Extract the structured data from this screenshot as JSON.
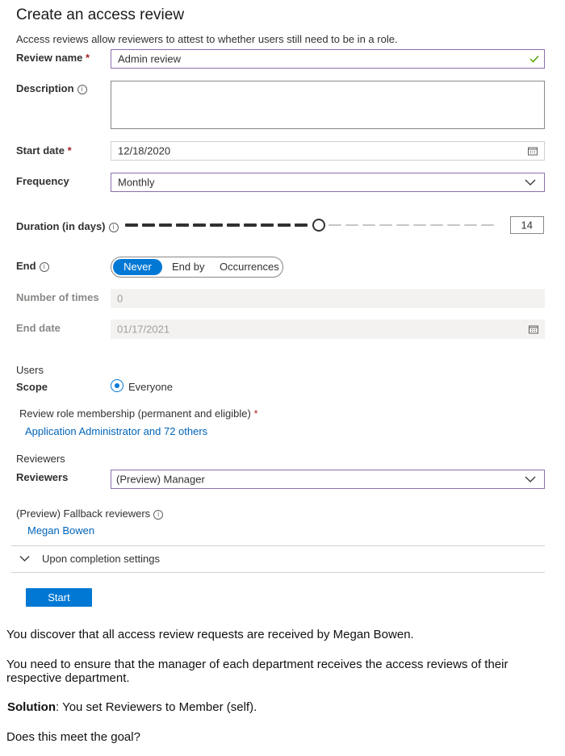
{
  "form": {
    "title": "Create an access review",
    "intro": "Access reviews allow reviewers to attest to whether users still need to be in a role.",
    "review_name": {
      "label": "Review name",
      "required_mark": "*",
      "value": "Admin review"
    },
    "description": {
      "label": "Description",
      "value": ""
    },
    "start_date": {
      "label": "Start date",
      "required_mark": "*",
      "value": "12/18/2020"
    },
    "frequency": {
      "label": "Frequency",
      "value": "Monthly"
    },
    "duration": {
      "label": "Duration (in days)",
      "value": "14",
      "slider_fraction": 0.51
    },
    "end": {
      "label": "End",
      "options": [
        "Never",
        "End by",
        "Occurrences"
      ],
      "selected": "Never"
    },
    "number_of_times": {
      "label": "Number of times",
      "value": "0"
    },
    "end_date": {
      "label": "End date",
      "value": "01/17/2021"
    },
    "users_section": "Users",
    "scope": {
      "label": "Scope",
      "option": "Everyone"
    },
    "role_membership": {
      "label": "Review role membership (permanent and eligible)",
      "required_mark": "*",
      "link": "Application Administrator and 72 others"
    },
    "reviewers_section": "Reviewers",
    "reviewers": {
      "label": "Reviewers",
      "value": "(Preview) Manager"
    },
    "fallback": {
      "label": "(Preview) Fallback reviewers",
      "link": "Megan Bowen"
    },
    "completion": {
      "label": "Upon completion settings"
    },
    "start_button": "Start"
  },
  "question": {
    "p1": "You discover that all access review requests are received by Megan Bowen.",
    "p2": "You need to ensure that the manager of each department receives the access reviews of their respective department.",
    "solution_label": "Solution",
    "solution_text": ": You set Reviewers to Member (self).",
    "p4": "Does this meet the goal?"
  },
  "colors": {
    "accent": "#0078d4",
    "focus_border": "#8c6fae",
    "link": "#0064b8",
    "valid_check": "#57a300"
  }
}
